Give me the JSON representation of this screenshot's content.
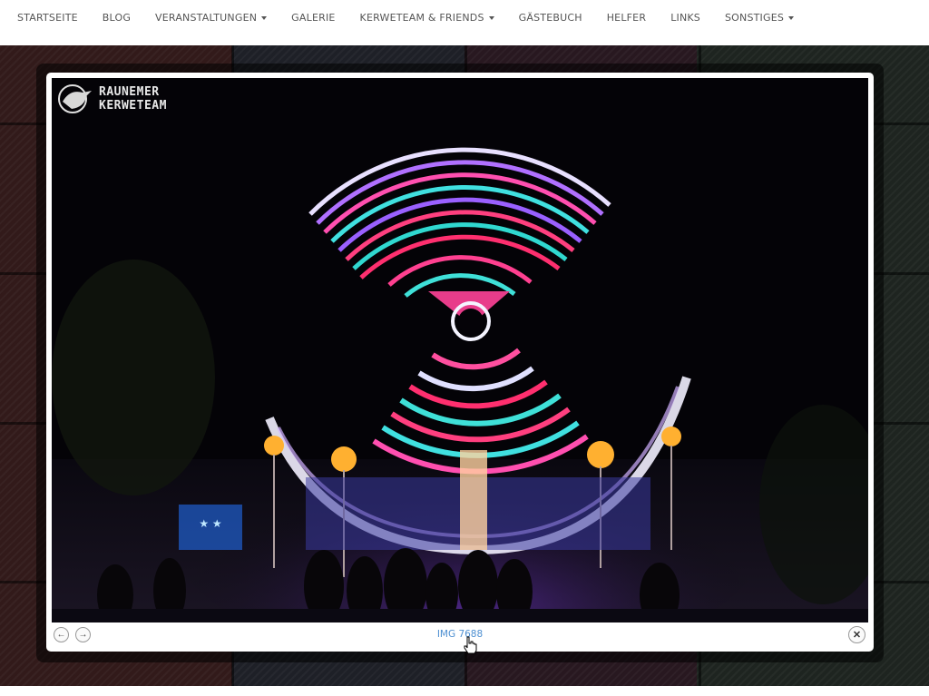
{
  "nav": {
    "items": [
      {
        "label": "STARTSEITE",
        "dropdown": false
      },
      {
        "label": "BLOG",
        "dropdown": false
      },
      {
        "label": "VERANSTALTUNGEN",
        "dropdown": true
      },
      {
        "label": "GALERIE",
        "dropdown": false
      },
      {
        "label": "KERWETEAM & FRIENDS",
        "dropdown": true
      },
      {
        "label": "GÄSTEBUCH",
        "dropdown": false
      },
      {
        "label": "HELFER",
        "dropdown": false
      },
      {
        "label": "LINKS",
        "dropdown": false
      },
      {
        "label": "SONSTIGES",
        "dropdown": true
      }
    ]
  },
  "lightbox": {
    "logo_line1": "RAUNEMER",
    "logo_line2": "KERWETEAM",
    "caption": "IMG 7688",
    "prev_icon": "arrow-left-icon",
    "next_icon": "arrow-right-icon",
    "close_icon": "close-icon"
  },
  "colors": {
    "nav_text": "#555555",
    "caption_link": "#4d8fd1",
    "overlay": "#1a1616"
  }
}
